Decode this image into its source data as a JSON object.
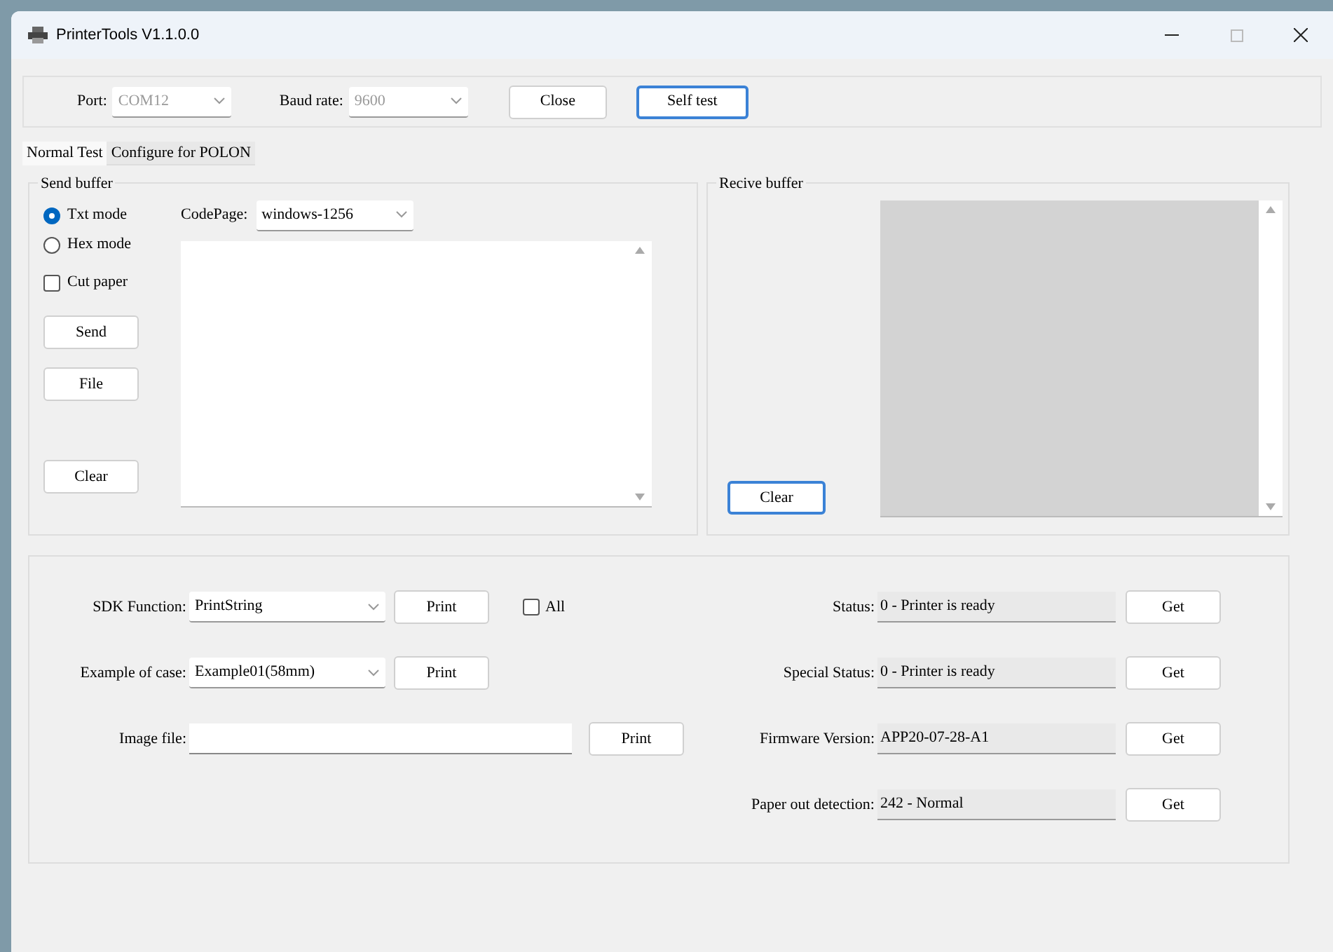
{
  "window": {
    "title": "PrinterTools V1.1.0.0"
  },
  "connection": {
    "port_label": "Port:",
    "port_value": "COM12",
    "baud_label": "Baud rate:",
    "baud_value": "9600",
    "buttons": [
      {
        "label": "Close",
        "focused": false
      },
      {
        "label": "Self test",
        "focused": true
      }
    ]
  },
  "tabs": [
    {
      "label": "Normal Test",
      "selected": true
    },
    {
      "label": "Configure for POLON",
      "selected": false
    }
  ],
  "send_buffer": {
    "title": "Send buffer",
    "modes": [
      {
        "label": "Txt mode",
        "selected": true
      },
      {
        "label": "Hex mode",
        "selected": false
      }
    ],
    "cut_paper": {
      "label": "Cut paper",
      "checked": false
    },
    "codepage_label": "CodePage:",
    "codepage_value": "windows-1256",
    "buttons": [
      {
        "label": "Send",
        "focused": false
      },
      {
        "label": "File",
        "focused": false
      },
      {
        "label": "Clear",
        "focused": false
      }
    ]
  },
  "receive_buffer": {
    "title": "Recive buffer",
    "clear": {
      "label": "Clear",
      "focused": true
    }
  },
  "functions": {
    "rows": [
      {
        "label": "SDK Function:",
        "kind": "select",
        "value": "PrintString",
        "button": "Print"
      },
      {
        "label": "Example of case:",
        "kind": "select",
        "value": "Example01(58mm)",
        "button": "Print"
      },
      {
        "label": "Image file:",
        "kind": "input",
        "value": "",
        "button": "Print"
      }
    ],
    "all": {
      "label": "All",
      "checked": false
    },
    "status_rows": [
      {
        "label": "Status:",
        "value": "0 - Printer is ready",
        "button": "Get"
      },
      {
        "label": "Special Status:",
        "value": "0 - Printer is ready",
        "button": "Get"
      },
      {
        "label": "Firmware Version:",
        "value": "APP20-07-28-A1",
        "button": "Get"
      },
      {
        "label": "Paper out detection:",
        "value": "242 - Normal",
        "button": "Get"
      }
    ]
  }
}
